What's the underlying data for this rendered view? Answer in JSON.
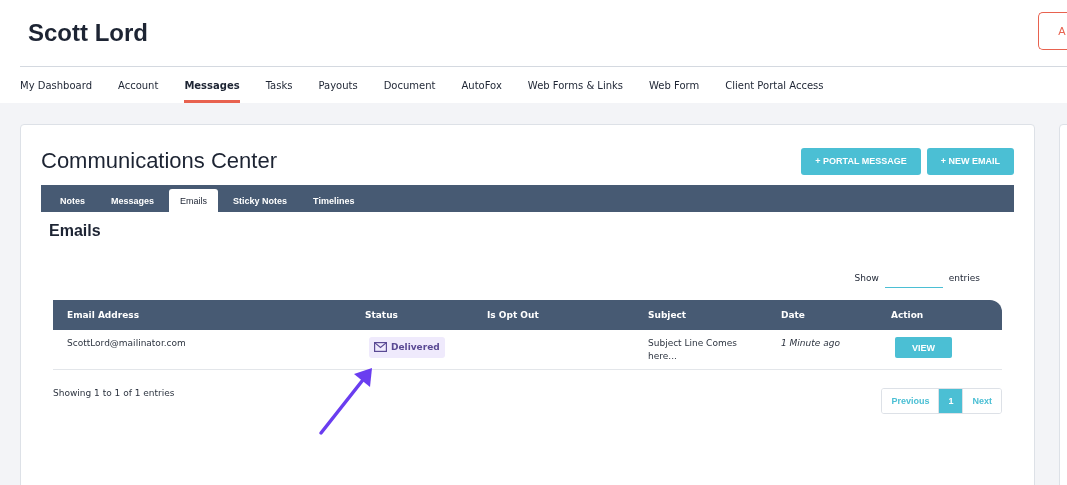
{
  "header": {
    "title": "Scott Lord",
    "corner_button": "A"
  },
  "nav": [
    {
      "label": "My Dashboard",
      "selected": false
    },
    {
      "label": "Account",
      "selected": false
    },
    {
      "label": "Messages",
      "selected": true
    },
    {
      "label": "Tasks",
      "selected": false
    },
    {
      "label": "Payouts",
      "selected": false
    },
    {
      "label": "Document",
      "selected": false
    },
    {
      "label": "AutoFox",
      "selected": false
    },
    {
      "label": "Web Forms & Links",
      "selected": false
    },
    {
      "label": "Web Form",
      "selected": false
    },
    {
      "label": "Client Portal Access",
      "selected": false
    }
  ],
  "card": {
    "title": "Communications Center",
    "buttons": [
      "+ PORTAL MESSAGE",
      "+ NEW EMAIL"
    ],
    "tabs": [
      {
        "label": "Notes",
        "selected": false
      },
      {
        "label": "Messages",
        "selected": false
      },
      {
        "label": "Emails",
        "selected": true
      },
      {
        "label": "Sticky Notes",
        "selected": false
      },
      {
        "label": "Timelines",
        "selected": false
      }
    ],
    "section_title": "Emails",
    "length": {
      "before": "Show",
      "after": "entries"
    },
    "table": {
      "columns": [
        "Email Address",
        "Status",
        "Is Opt Out",
        "Subject",
        "Date",
        "Action"
      ],
      "rows": [
        {
          "email": "ScottLord@mailinator.com",
          "status": "Delivered",
          "subject": "Subject Line Comes here...",
          "date": "1 Minute ago",
          "action": "VIEW"
        }
      ]
    },
    "info": "Showing 1 to 1 of 1 entries",
    "pagination": [
      {
        "label": "Previous",
        "selected": false
      },
      {
        "label": "1",
        "selected": true
      },
      {
        "label": "Next",
        "selected": false
      }
    ]
  }
}
